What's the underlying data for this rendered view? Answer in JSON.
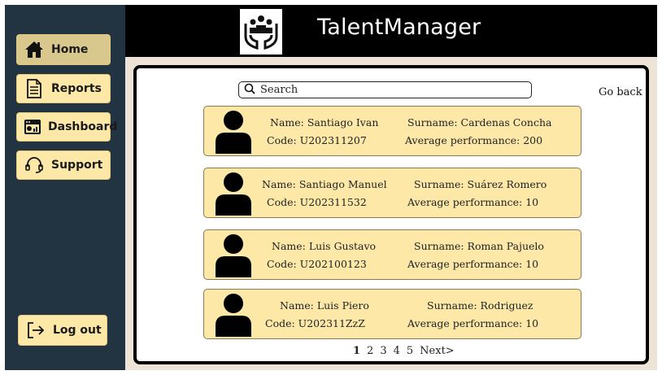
{
  "sidebar": {
    "items": [
      {
        "label": "Home",
        "icon": "home-icon"
      },
      {
        "label": "Reports",
        "icon": "document-icon"
      },
      {
        "label": "Dashboard",
        "icon": "dashboard-icon"
      },
      {
        "label": "Support",
        "icon": "headset-icon"
      }
    ],
    "logout_label": "Log out"
  },
  "header": {
    "title": "TalentManager",
    "logo_icon": "people-hands-logo"
  },
  "main": {
    "search_placeholder": "Search",
    "go_back": "Go back",
    "employees": [
      {
        "name": "Name: Santiago Ivan",
        "surname": "Surname: Cardenas Concha",
        "code": "Code: U202311207",
        "performance": "Average performance: 200"
      },
      {
        "name": "Name: Santiago Manuel",
        "surname": "Surname: Suárez Romero",
        "code": "Code: U202311532",
        "performance": "Average performance: 10"
      },
      {
        "name": "Name: Luis Gustavo",
        "surname": "Surname: Roman Pajuelo",
        "code": "Code: U202100123",
        "performance": "Average performance: 10"
      },
      {
        "name": "Name: Luis Piero",
        "surname": "Surname: Rodriguez",
        "code": "Code:  U202311ZzZ",
        "performance": "Average performance: 10"
      }
    ],
    "pagination": {
      "pages": [
        "1",
        "2",
        "3",
        "4",
        "5"
      ],
      "next": "Next>"
    }
  },
  "colors": {
    "sidebar": "#223341",
    "button": "#fde8a8",
    "header": "#000000",
    "background": "#ede3d7"
  }
}
